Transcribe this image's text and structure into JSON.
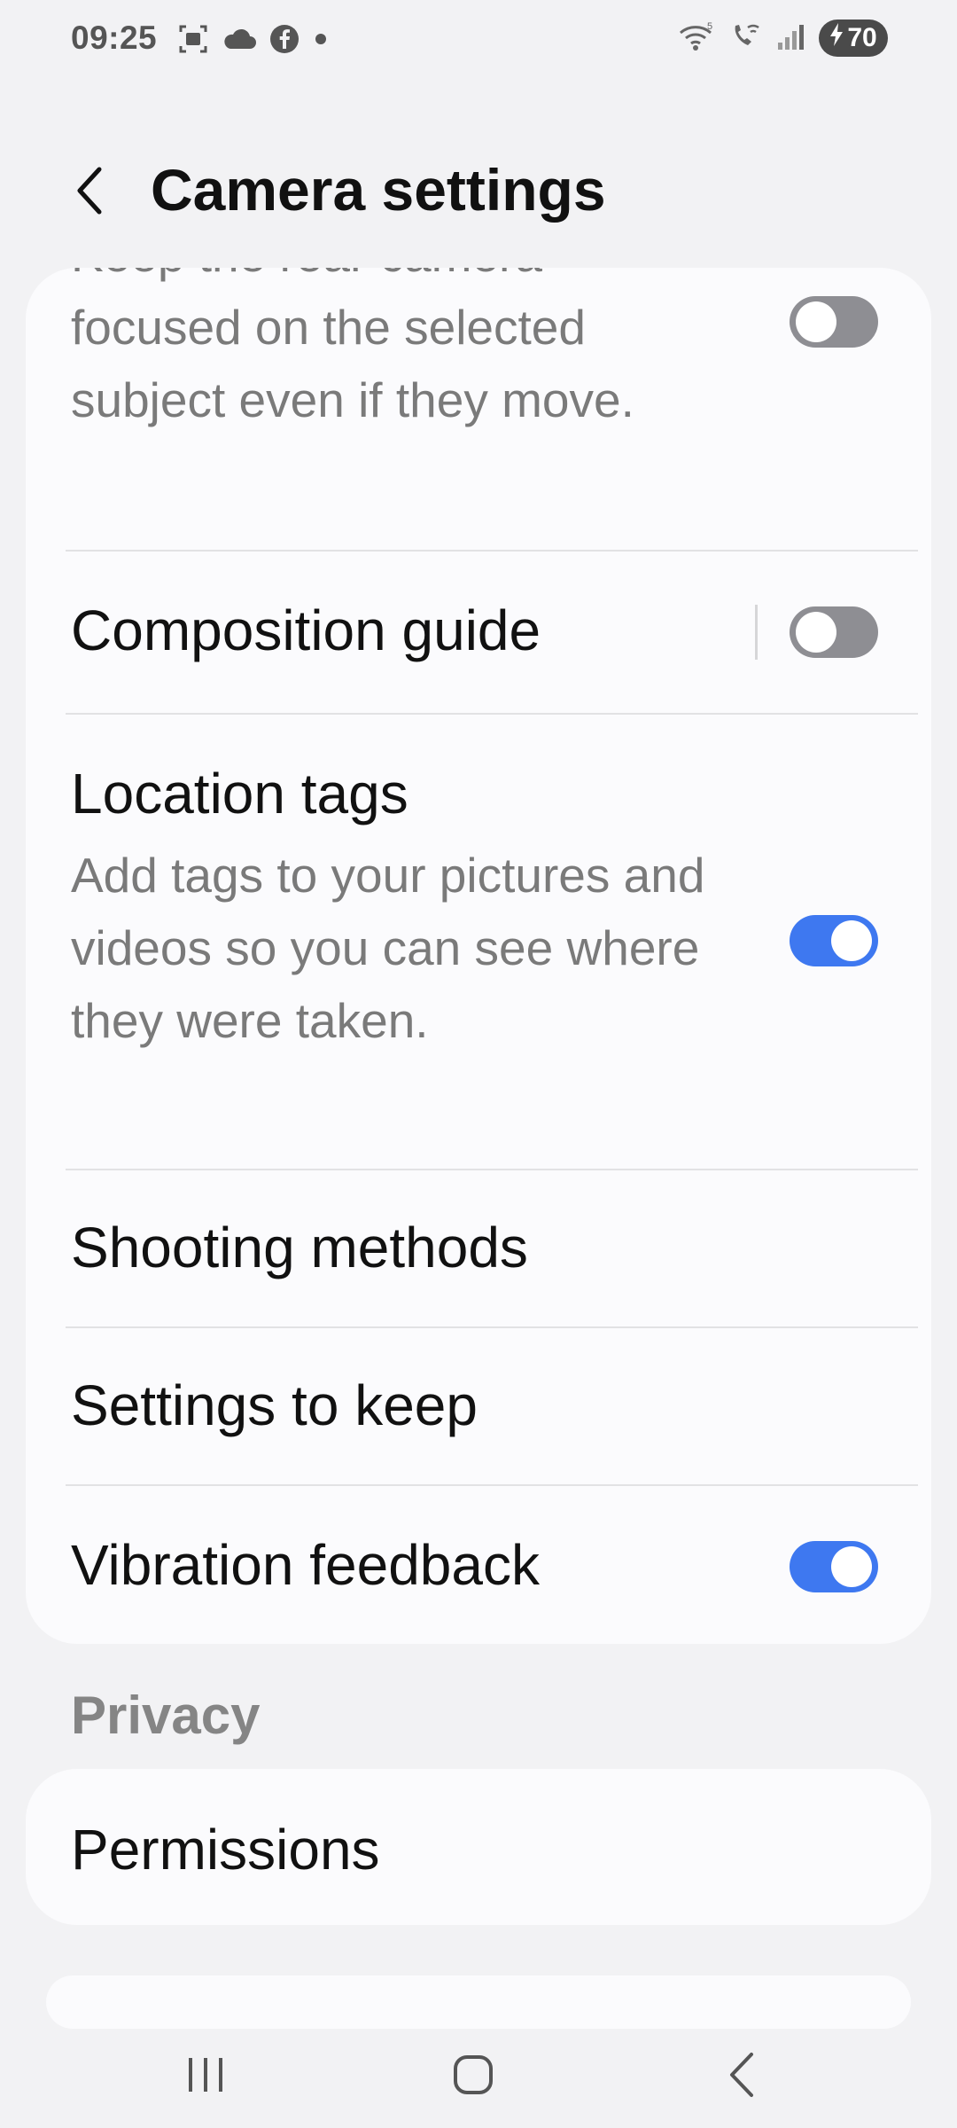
{
  "status_bar": {
    "time": "09:25",
    "left_icons": [
      "screenshot-icon",
      "cloud-icon",
      "facebook-icon",
      "dot-icon"
    ],
    "right_icons": [
      "wifi-icon",
      "wifi-call-icon",
      "signal-icon"
    ],
    "battery_level": "70",
    "charging": true
  },
  "header": {
    "title": "Camera settings"
  },
  "settings": {
    "tracking_desc": "Keep the rear camera focused on the selected subject even if they move.",
    "tracking_toggle": false,
    "composition_guide": {
      "label": "Composition guide",
      "enabled": false
    },
    "location_tags": {
      "label": "Location tags",
      "description": "Add tags to your pictures and videos so you can see where they were taken.",
      "enabled": true
    },
    "shooting_methods": {
      "label": "Shooting methods"
    },
    "settings_to_keep": {
      "label": "Settings to keep"
    },
    "vibration_feedback": {
      "label": "Vibration feedback",
      "enabled": true
    }
  },
  "privacy": {
    "section_title": "Privacy",
    "permissions_label": "Permissions"
  },
  "colors": {
    "accent": "#3e78f0",
    "toggle_off": "#8e8e93",
    "background": "#f2f2f4",
    "card": "#fbfbfd"
  },
  "navbar": {
    "icons": [
      "recents-icon",
      "home-icon",
      "back-icon"
    ]
  }
}
